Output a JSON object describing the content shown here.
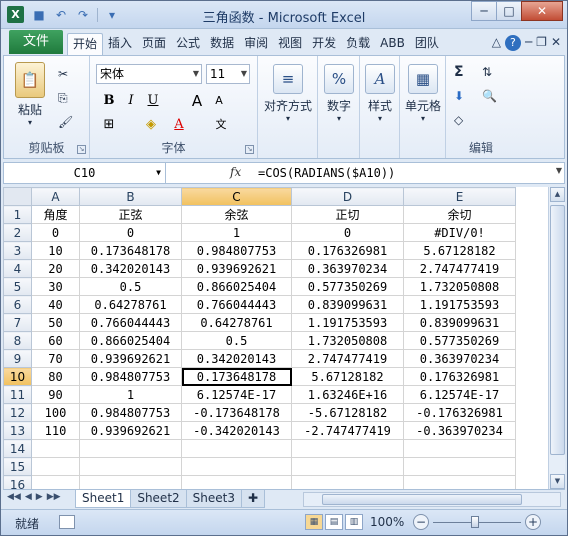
{
  "window": {
    "title": "三角函数 - Microsoft Excel",
    "app_icon": "X",
    "controls": [
      "─",
      "□",
      "✕"
    ]
  },
  "qat": [
    "💾",
    "↶",
    "↷",
    "🖫"
  ],
  "ribbon_tabs": {
    "file": "文件",
    "tabs": [
      "开始",
      "插入",
      "页面",
      "公式",
      "数据",
      "审阅",
      "视图",
      "开发",
      "负载",
      "ABB",
      "团队"
    ],
    "active": "开始",
    "right_icons": [
      "△",
      "?",
      "─",
      "❐",
      "✕"
    ]
  },
  "ribbon": {
    "clipboard": {
      "paste_label": "粘贴",
      "group_label": "剪贴板"
    },
    "font": {
      "font_name": "宋体",
      "font_size": "11",
      "bold": "B",
      "italic": "I",
      "underline": "U",
      "grow": "A",
      "shrink": "A",
      "group_label": "字体"
    },
    "alignment": {
      "label": "对齐方式"
    },
    "number": {
      "label": "数字",
      "icon": "%"
    },
    "styles": {
      "label": "样式"
    },
    "cells": {
      "label": "单元格"
    },
    "editing": {
      "group_label": "编辑",
      "sum": "Σ"
    }
  },
  "formula_bar": {
    "name_box": "C10",
    "fx": "fx",
    "formula": "=COS(RADIANS($A10))"
  },
  "grid": {
    "columns": [
      "A",
      "B",
      "C",
      "D",
      "E"
    ],
    "selected_column": "C",
    "selected_row": "10",
    "rows": [
      {
        "num": "1",
        "cells": [
          "角度",
          "正弦",
          "余弦",
          "正切",
          "余切"
        ]
      },
      {
        "num": "2",
        "cells": [
          "0",
          "0",
          "1",
          "0",
          "#DIV/0!"
        ]
      },
      {
        "num": "3",
        "cells": [
          "10",
          "0.173648178",
          "0.984807753",
          "0.176326981",
          "5.67128182"
        ]
      },
      {
        "num": "4",
        "cells": [
          "20",
          "0.342020143",
          "0.939692621",
          "0.363970234",
          "2.747477419"
        ]
      },
      {
        "num": "5",
        "cells": [
          "30",
          "0.5",
          "0.866025404",
          "0.577350269",
          "1.732050808"
        ]
      },
      {
        "num": "6",
        "cells": [
          "40",
          "0.64278761",
          "0.766044443",
          "0.839099631",
          "1.191753593"
        ]
      },
      {
        "num": "7",
        "cells": [
          "50",
          "0.766044443",
          "0.64278761",
          "1.191753593",
          "0.839099631"
        ]
      },
      {
        "num": "8",
        "cells": [
          "60",
          "0.866025404",
          "0.5",
          "1.732050808",
          "0.577350269"
        ]
      },
      {
        "num": "9",
        "cells": [
          "70",
          "0.939692621",
          "0.342020143",
          "2.747477419",
          "0.363970234"
        ]
      },
      {
        "num": "10",
        "cells": [
          "80",
          "0.984807753",
          "0.173648178",
          "5.67128182",
          "0.176326981"
        ]
      },
      {
        "num": "11",
        "cells": [
          "90",
          "1",
          "6.12574E-17",
          "1.63246E+16",
          "6.12574E-17"
        ]
      },
      {
        "num": "12",
        "cells": [
          "100",
          "0.984807753",
          "-0.173648178",
          "-5.67128182",
          "-0.176326981"
        ]
      },
      {
        "num": "13",
        "cells": [
          "110",
          "0.939692621",
          "-0.342020143",
          "-2.747477419",
          "-0.363970234"
        ]
      },
      {
        "num": "14",
        "cells": [
          "",
          "",
          "",
          "",
          ""
        ]
      },
      {
        "num": "15",
        "cells": [
          "",
          "",
          "",
          "",
          ""
        ]
      },
      {
        "num": "16",
        "cells": [
          "",
          "",
          "",
          "",
          ""
        ]
      }
    ]
  },
  "sheets": {
    "nav": [
      "◀◀",
      "◀",
      "▶",
      "▶▶"
    ],
    "tabs": [
      "Sheet1",
      "Sheet2",
      "Sheet3"
    ],
    "active": "Sheet1"
  },
  "status": {
    "ready": "就绪",
    "zoom": "100%"
  }
}
